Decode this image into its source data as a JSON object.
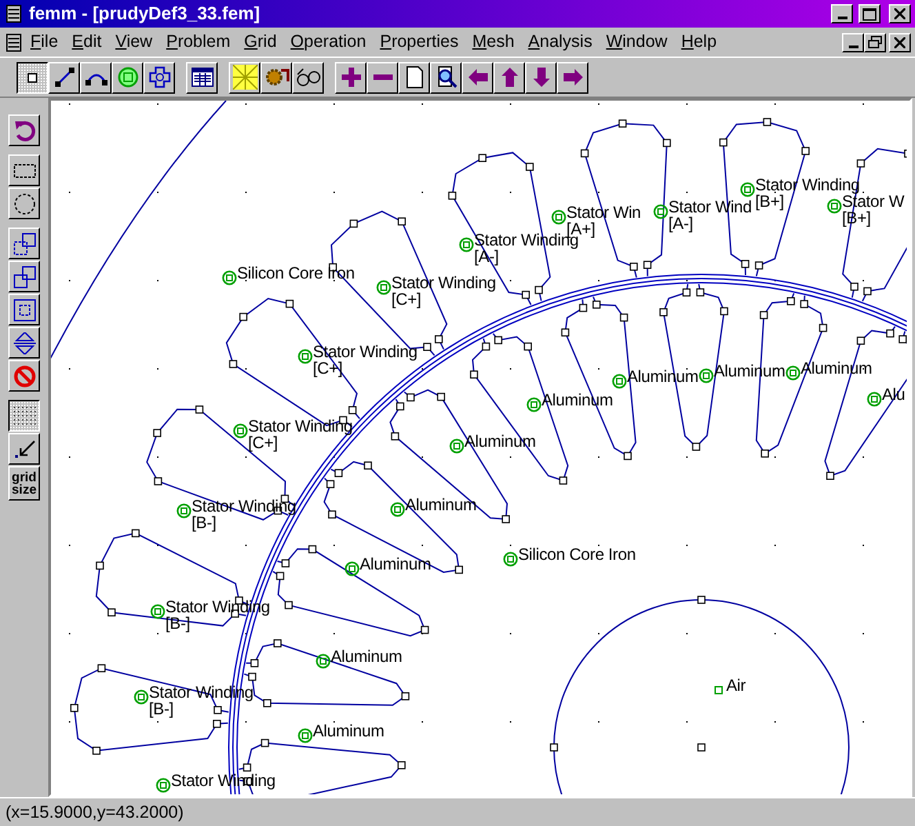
{
  "window": {
    "title": "femm - [prudyDef3_33.fem]"
  },
  "menu": [
    "File",
    "Edit",
    "View",
    "Problem",
    "Grid",
    "Operation",
    "Properties",
    "Mesh",
    "Analysis",
    "Window",
    "Help"
  ],
  "toolbar": [
    [
      {
        "selected": true
      },
      {
        "selected": false
      },
      {
        "selected": false
      },
      {
        "selected": false
      },
      {
        "selected": false
      }
    ],
    [
      {
        "selected": false
      }
    ],
    [
      {
        "selected": false
      },
      {
        "selected": false
      },
      {
        "selected": false
      }
    ],
    [
      {
        "selected": false
      },
      {
        "selected": false
      },
      {
        "selected": false
      },
      {
        "selected": false
      },
      {
        "selected": false
      },
      {
        "selected": false
      },
      {
        "selected": false
      },
      {
        "selected": false
      }
    ]
  ],
  "side_toolbar": [
    [
      {
        "selected": false
      }
    ],
    [
      {
        "selected": false
      },
      {
        "selected": false
      }
    ],
    [
      {
        "selected": false
      },
      {
        "selected": false
      },
      {
        "selected": false
      },
      {
        "selected": false
      },
      {
        "selected": false
      }
    ],
    [
      {
        "selected": true
      },
      {
        "selected": false
      },
      {
        "selected": false,
        "label": "grid size"
      }
    ]
  ],
  "canvas": {
    "labels": [
      {
        "kind": "ringed",
        "text": "Stator Winding",
        "circuit": "[B+]"
      },
      {
        "kind": "ringed",
        "text": "Stator Win",
        "circuit": "[A+]"
      },
      {
        "kind": "ringed",
        "text": "Stator Wind",
        "circuit": "[A-]"
      },
      {
        "kind": "ringed",
        "text": "Stator W",
        "circuit": "[B+]"
      },
      {
        "kind": "ringed",
        "text": "Stator Winding",
        "circuit": "[A-]"
      },
      {
        "kind": "ringed",
        "text": "Silicon Core Iron"
      },
      {
        "kind": "ringed",
        "text": "Stator Winding",
        "circuit": "[C+]"
      },
      {
        "kind": "ringed",
        "text": "Stator Winding",
        "circuit": "[C+]"
      },
      {
        "kind": "ringed",
        "text": "Aluminum"
      },
      {
        "kind": "ringed",
        "text": "Aluminum"
      },
      {
        "kind": "ringed",
        "text": "Aluminum"
      },
      {
        "kind": "ringed",
        "text": "Alu"
      },
      {
        "kind": "ringed",
        "text": "Aluminum"
      },
      {
        "kind": "ringed",
        "text": "Stator Winding",
        "circuit": "[C+]"
      },
      {
        "kind": "ringed",
        "text": "Aluminum"
      },
      {
        "kind": "ringed",
        "text": "Aluminum"
      },
      {
        "kind": "ringed",
        "text": "Stator Winding",
        "circuit": "[B-]"
      },
      {
        "kind": "ringed",
        "text": "Aluminum"
      },
      {
        "kind": "ringed",
        "text": "Silicon Core Iron"
      },
      {
        "kind": "ringed",
        "text": "Stator Winding",
        "circuit": "[B-]"
      },
      {
        "kind": "ringed",
        "text": "Aluminum"
      },
      {
        "kind": "plain",
        "text": "Air"
      },
      {
        "kind": "ringed",
        "text": "Stator Winding",
        "circuit": "[B-]"
      },
      {
        "kind": "ringed",
        "text": "Aluminum"
      },
      {
        "kind": "ringed",
        "text": "Stator Winding"
      }
    ]
  },
  "status_bar": "(x=15.9000,y=43.2000)"
}
